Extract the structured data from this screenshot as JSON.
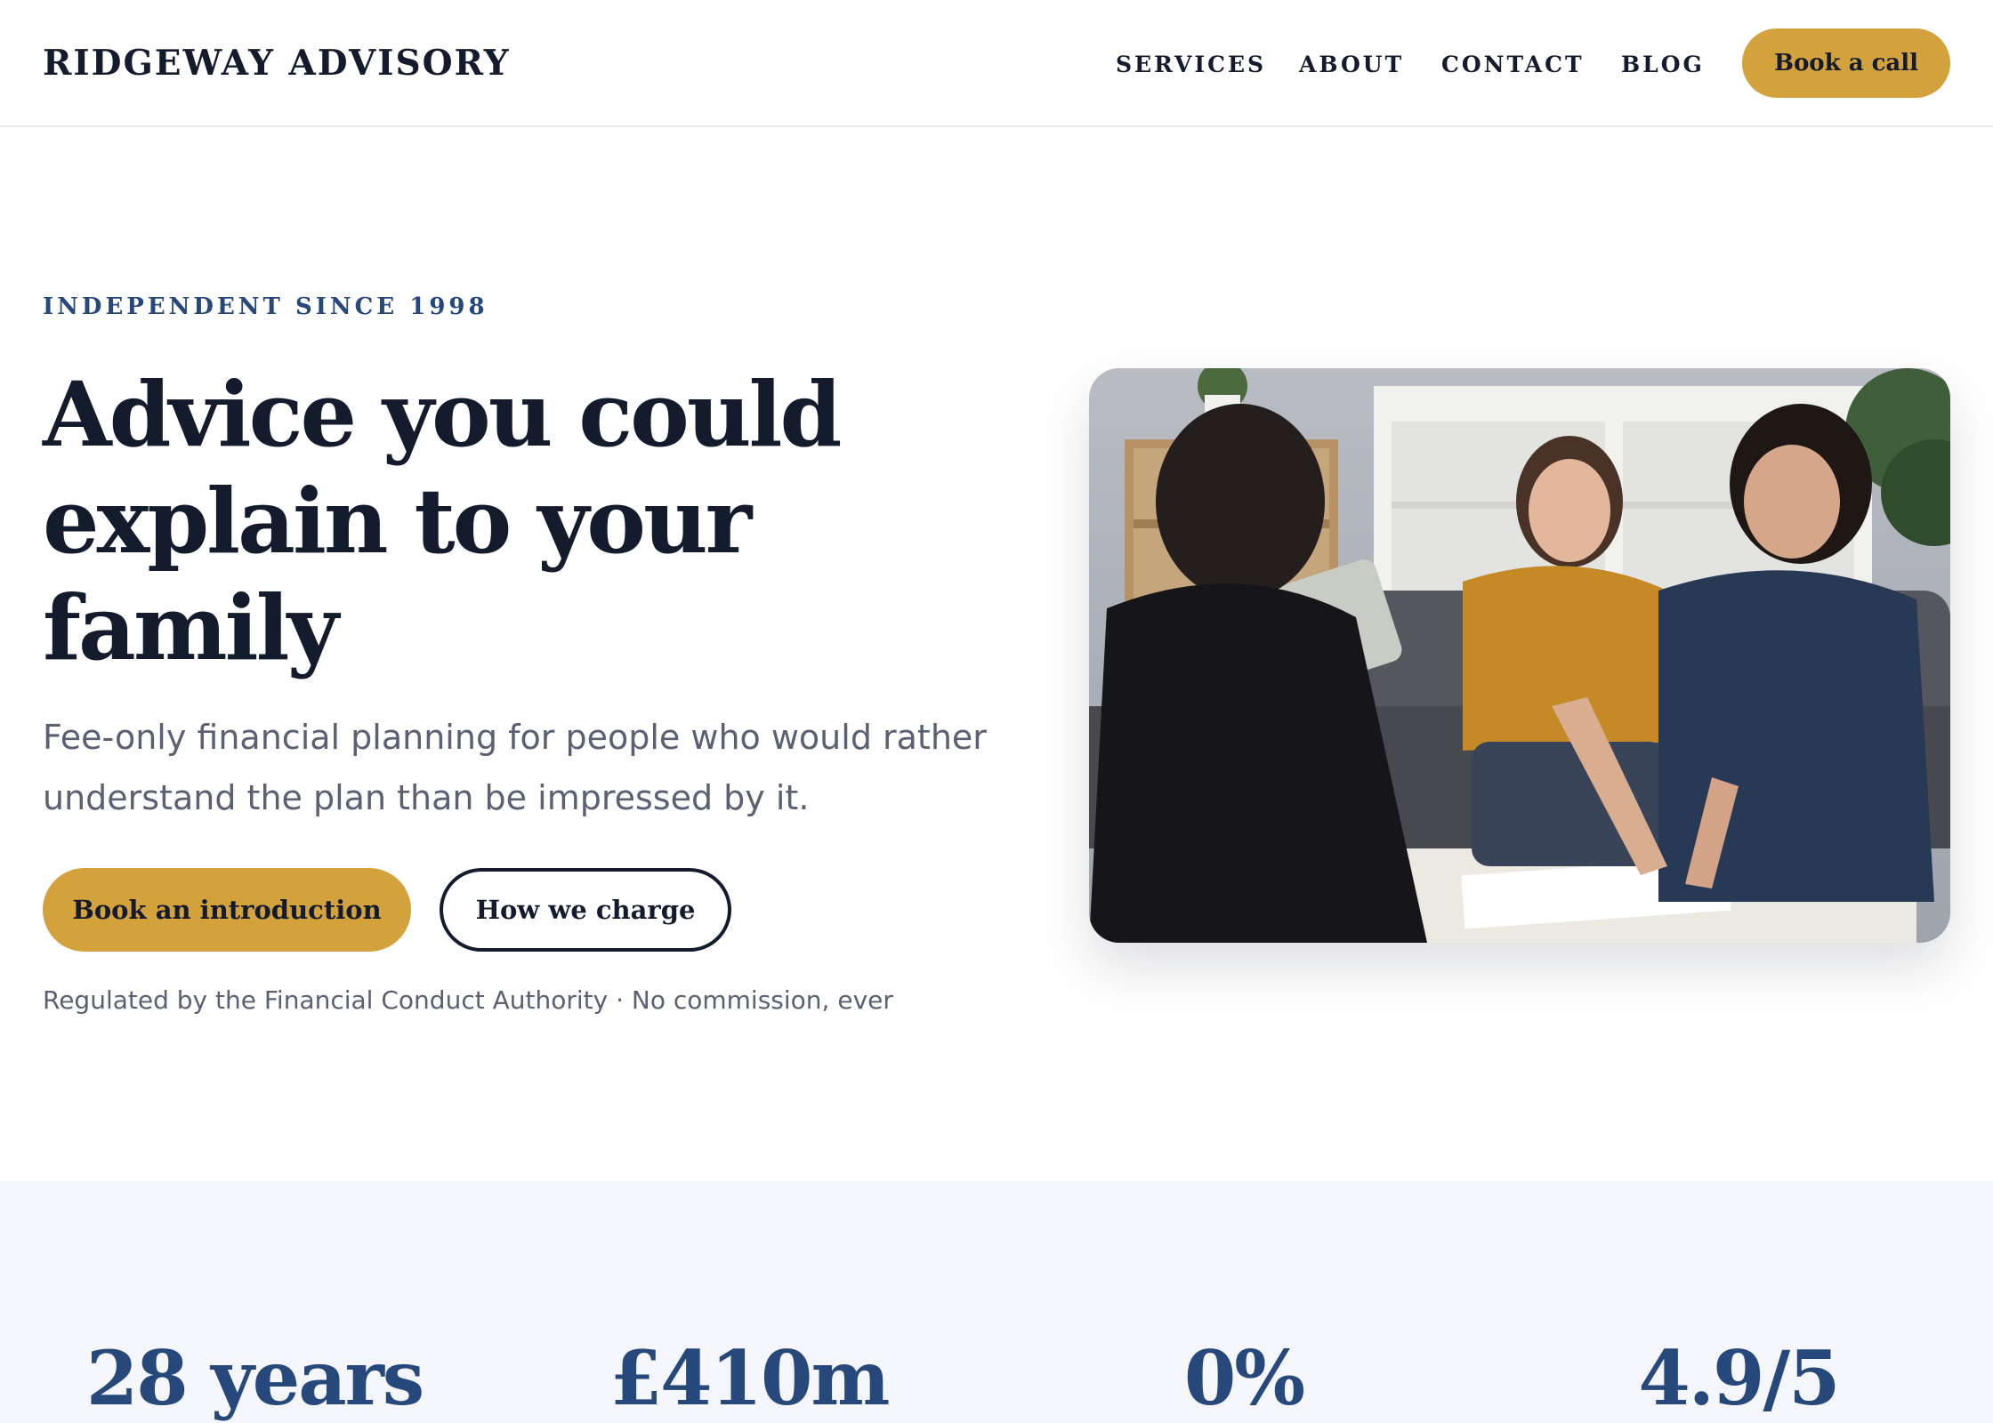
{
  "header": {
    "logo": "RIDGEWAY ADVISORY",
    "nav": [
      "SERVICES",
      "ABOUT",
      "CONTACT",
      "BLOG"
    ],
    "cta": "Book a call"
  },
  "hero": {
    "eyebrow": "INDEPENDENT SINCE 1998",
    "headline": "Advice you could explain to your family",
    "lead": "Fee-only financial planning for people who would rather understand the plan than be impressed by it.",
    "primary_button": "Book an introduction",
    "secondary_button": "How we charge",
    "regulated_note": "Regulated by the Financial Conduct Authority · No commission, ever"
  },
  "stats": [
    "28 years",
    "£410m",
    "0%",
    "4.9/5"
  ],
  "colors": {
    "accent": "#d4a23c",
    "navy": "#27487a",
    "ink": "#141b2d",
    "muted": "#5b6072",
    "band": "#f5f6fb"
  }
}
